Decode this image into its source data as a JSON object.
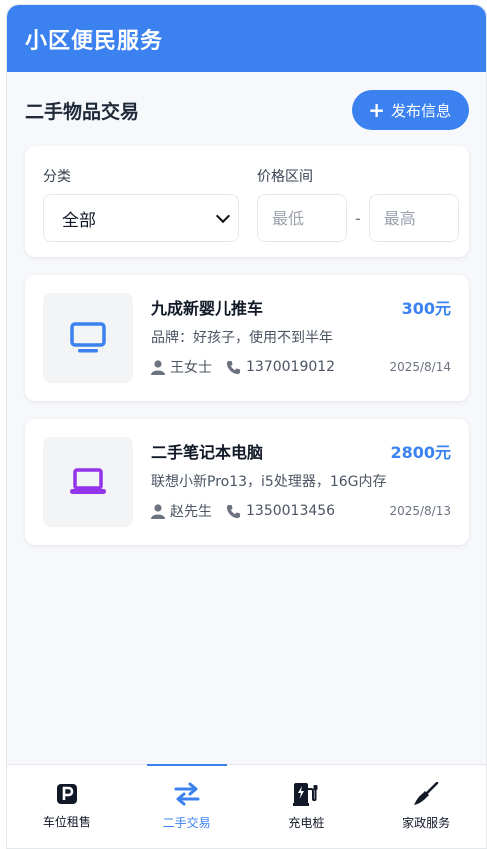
{
  "app": {
    "title": "小区便民服务"
  },
  "section": {
    "title": "二手物品交易",
    "publish_label": "发布信息"
  },
  "filter": {
    "category_label": "分类",
    "category_value": "全部",
    "price_label": "价格区间",
    "min_placeholder": "最低",
    "max_placeholder": "最高",
    "separator": "-"
  },
  "items": [
    {
      "title": "九成新婴儿推车",
      "price": "300元",
      "desc": "品牌：好孩子，使用不到半年",
      "contact": "王女士",
      "phone": "1370019012",
      "date": "2025/8/14",
      "icon": "monitor-icon",
      "icon_color": "#3b82f0"
    },
    {
      "title": "二手笔记本电脑",
      "price": "2800元",
      "desc": "联想小新Pro13，i5处理器，16G内存",
      "contact": "赵先生",
      "phone": "1350013456",
      "date": "2025/8/13",
      "icon": "laptop-icon",
      "icon_color": "#9333ea"
    }
  ],
  "nav": [
    {
      "label": "车位租售",
      "icon": "parking-icon",
      "active": false
    },
    {
      "label": "二手交易",
      "icon": "exchange-icon",
      "active": true
    },
    {
      "label": "充电桩",
      "icon": "charging-station-icon",
      "active": false
    },
    {
      "label": "家政服务",
      "icon": "broom-icon",
      "active": false
    }
  ],
  "colors": {
    "primary": "#3b82f0",
    "background": "#f6f8fb"
  }
}
